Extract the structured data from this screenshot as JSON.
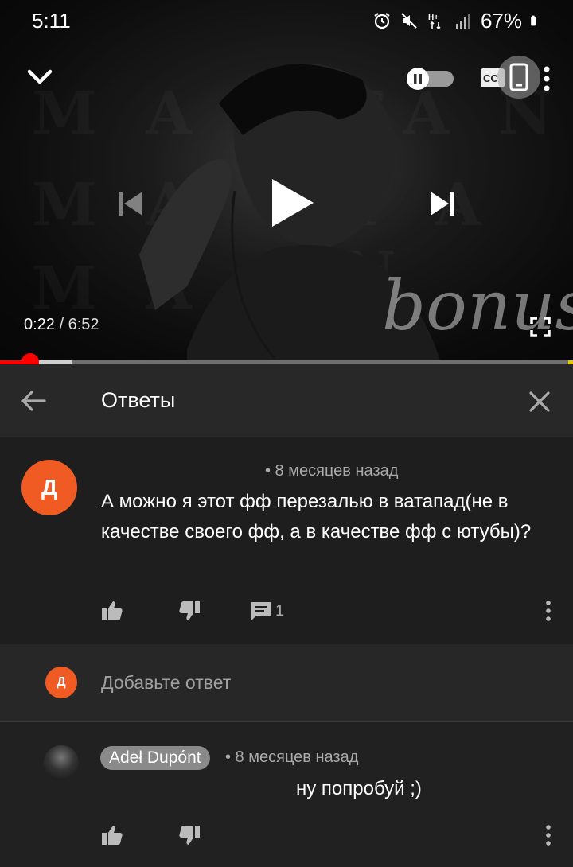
{
  "status_bar": {
    "time": "5:11",
    "battery": "67%",
    "icons": [
      "alarm-icon",
      "mute-icon",
      "network-h-plus-icon",
      "signal-icon",
      "battery-icon"
    ]
  },
  "player": {
    "current_time": "0:22",
    "separator": " / ",
    "duration": "6:52",
    "progress_fraction": 0.053,
    "buffered_fraction": 0.125,
    "overlay_word": "bonus",
    "background_letters": [
      "MADE",
      "MAT",
      "MA",
      "TAN",
      "MADE"
    ],
    "icons": [
      "chevron-down-icon",
      "autoplay-toggle-icon",
      "captions-icon",
      "cast-icon",
      "more-vert-icon",
      "previous-icon",
      "play-icon",
      "next-icon",
      "fullscreen-icon"
    ]
  },
  "replies_panel": {
    "title": "Ответы",
    "icons": [
      "arrow-back-icon",
      "close-icon"
    ]
  },
  "comment": {
    "avatar_letter": "Д",
    "meta": "• 8 месяцев назад",
    "text": "А можно я этот фф перезалью в ватапад(не в качестве своего фф, а в качестве фф с ютубы)?",
    "reply_count": "1"
  },
  "add_reply": {
    "avatar_letter": "Д",
    "placeholder": "Добавьте ответ"
  },
  "reply": {
    "author": "Adeł Dupónt",
    "meta": "• 8 месяцев назад",
    "text": "ну попробуй ;)"
  },
  "colors": {
    "accent_red": "#ff0000",
    "avatar_orange": "#f05a23",
    "panel_bg": "#212121"
  }
}
